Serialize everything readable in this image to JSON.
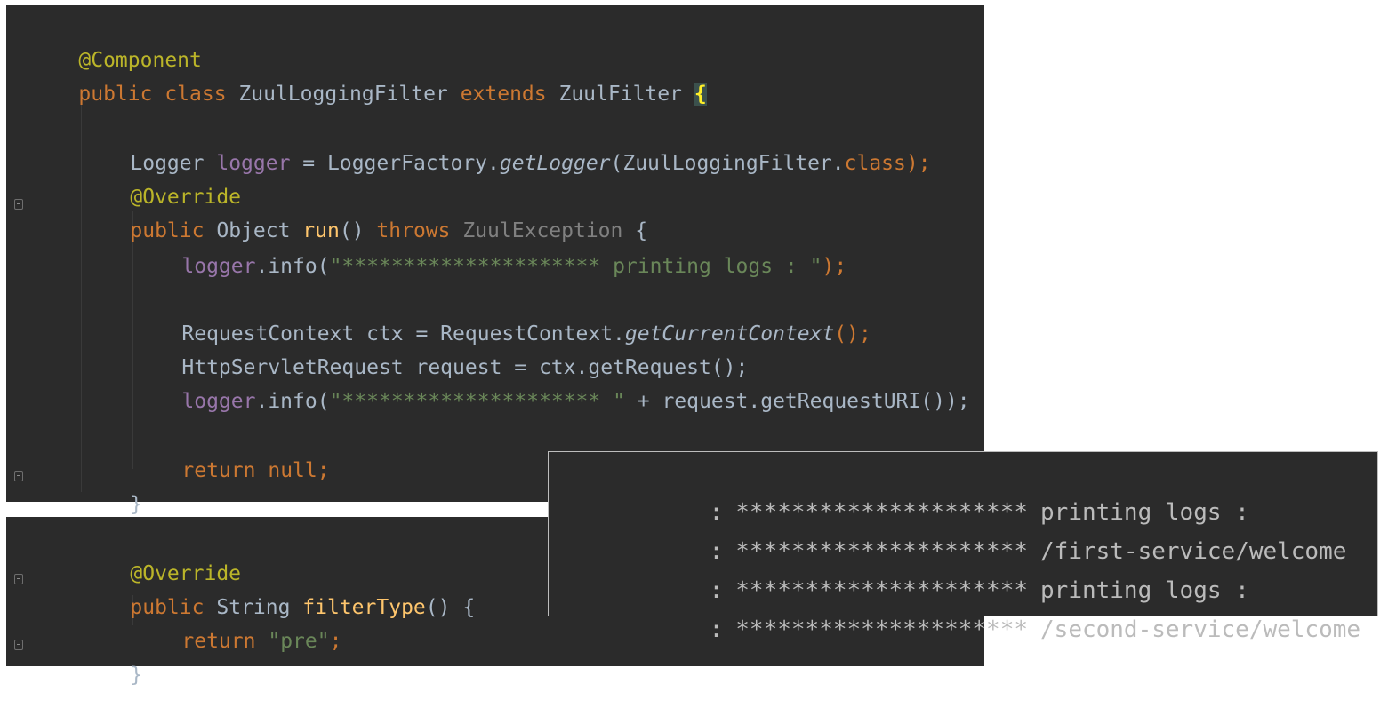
{
  "editor_top": {
    "lines": [
      {
        "anno": "@Component"
      },
      {
        "kw1": "public class",
        "name": "ZuulLoggingFilter",
        "kw2": "extends",
        "parent": "ZuulFilter",
        "brace": "{"
      },
      {
        "type": "Logger",
        "field": "logger",
        "eq": "=",
        "factory": "LoggerFactory.",
        "method": "getLogger",
        "open": "(ZuulLoggingFilter.",
        "cls": "class",
        "close": ");"
      },
      {
        "anno": "@Override"
      },
      {
        "kw": "public",
        "type": "Object",
        "method": "run",
        "parens": "()",
        "kw2": "throws",
        "exc": "ZuulException",
        "brace": "{"
      },
      {
        "field": "logger",
        "call": ".info(",
        "str": "\"********************* printing logs : \"",
        "close": ");"
      },
      {
        "pre": "RequestContext ctx = RequestContext.",
        "method": "getCurrentContext",
        "close": "();"
      },
      {
        "text": "HttpServletRequest request = ctx.getRequest();"
      },
      {
        "field": "logger",
        "call": ".info(",
        "str": "\"********************* \"",
        "rest": " + request.getRequestURI());"
      },
      {
        "kw": "return",
        "kw2": "null;"
      },
      {
        "brace": "}"
      }
    ]
  },
  "editor_bottom": {
    "lines": [
      {
        "anno": "@Override"
      },
      {
        "kw": "public",
        "type": "String",
        "method": "filterType",
        "parens": "()",
        "brace": "{"
      },
      {
        "kw": "return",
        "str": "\"pre\"",
        "semi": ";"
      },
      {
        "brace": "}"
      }
    ]
  },
  "console": {
    "lines": [
      {
        "sep": ":",
        "stars": "*********************",
        "msg": "printing logs :"
      },
      {
        "sep": ":",
        "stars": "*********************",
        "msg": "/first-service/welcome"
      },
      {
        "sep": ":",
        "stars": "*********************",
        "msg": "printing logs :"
      },
      {
        "sep": ":",
        "stars": "*********************",
        "msg": "/second-service/welcome"
      }
    ]
  },
  "colors": {
    "background": "#2b2b2b",
    "keyword": "#cc7832",
    "annotation": "#bbb529",
    "method": "#ffc66d",
    "string": "#6a8759",
    "field": "#9876aa",
    "text": "#a9b7c6"
  }
}
